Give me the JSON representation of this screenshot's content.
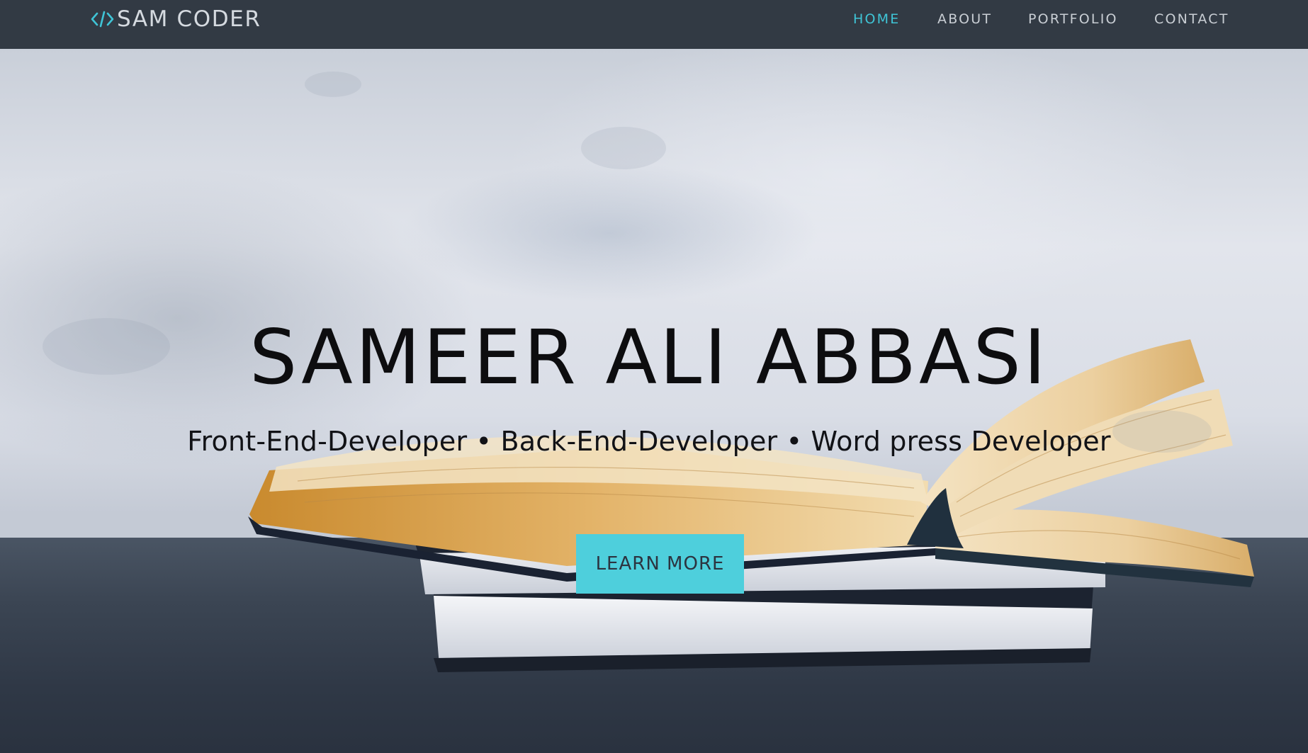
{
  "brand": {
    "icon": "code-brackets-icon",
    "name": "SAM CODER"
  },
  "nav": {
    "items": [
      {
        "label": "HOME",
        "active": true
      },
      {
        "label": "ABOUT",
        "active": false
      },
      {
        "label": "PORTFOLIO",
        "active": false
      },
      {
        "label": "CONTACT",
        "active": false
      }
    ]
  },
  "hero": {
    "title": "SAMEER ALI ABBASI",
    "subtitle": "Front-End-Developer • Back-End-Developer • Word press Developer",
    "cta_label": "LEARN MORE",
    "background": "open-book-on-stack-photo"
  },
  "colors": {
    "navbar_bg": "#323a44",
    "accent": "#3fc4d6",
    "cta_bg": "#4ecfdc",
    "nav_text": "#c9ced4",
    "title_text": "#0d0d0f"
  }
}
